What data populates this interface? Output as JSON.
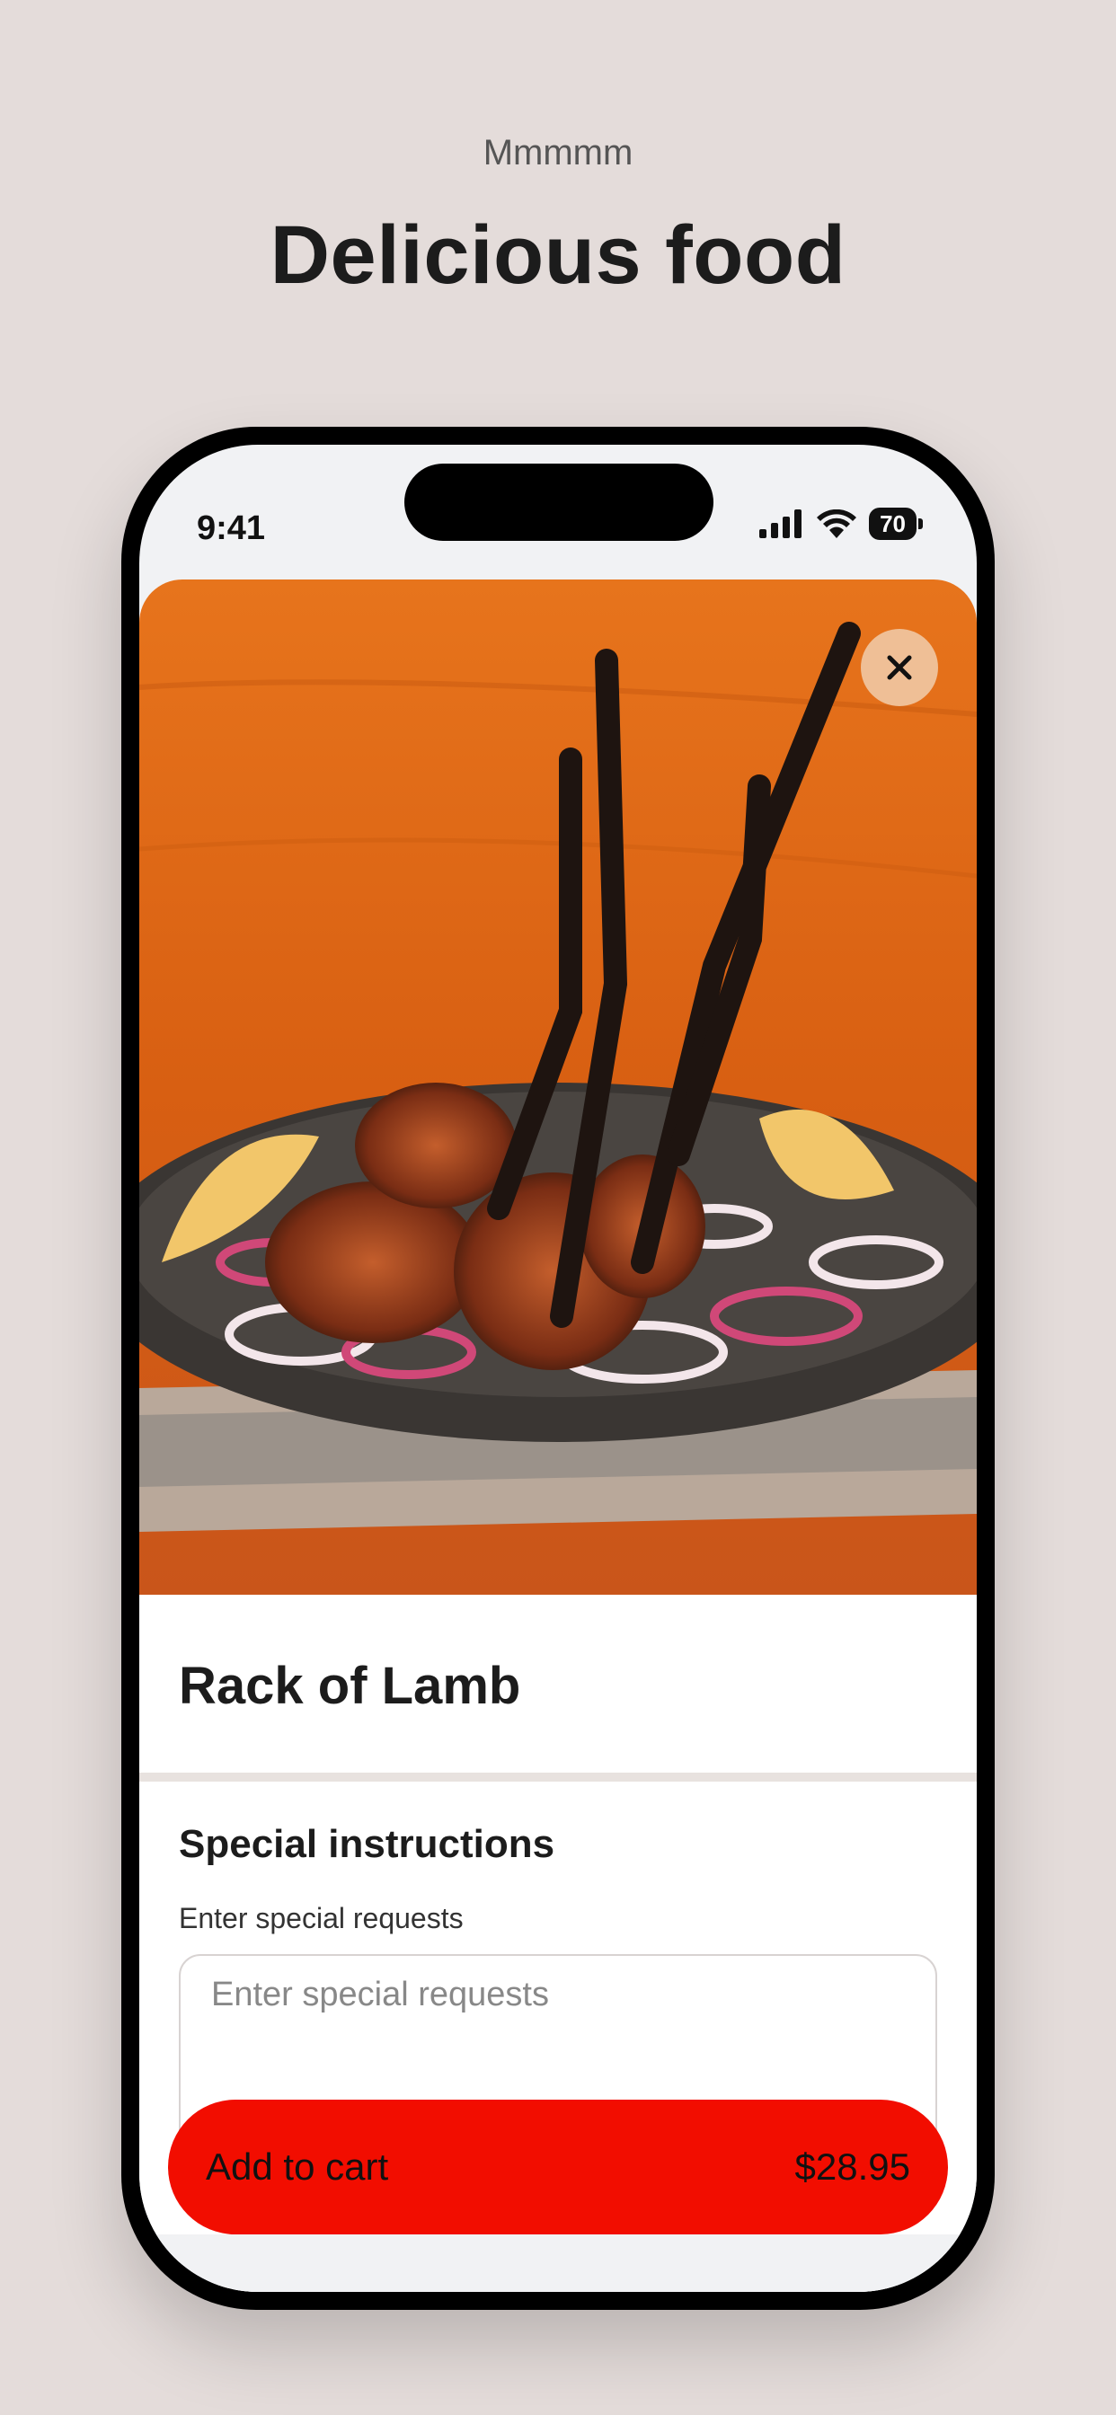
{
  "promo": {
    "subtitle": "Mmmmm",
    "title": "Delicious food"
  },
  "status_bar": {
    "time": "9:41",
    "battery": "70"
  },
  "item": {
    "name": "Rack of Lamb",
    "image_icon": "food-photo"
  },
  "special_instructions": {
    "title": "Special instructions",
    "label": "Enter special requests",
    "placeholder": "Enter special requests",
    "value": ""
  },
  "cart_button": {
    "label": "Add to cart",
    "price": "$28.95"
  },
  "colors": {
    "background": "#e4dcda",
    "cart_button": "#f20d00",
    "close_button": "#efbf96"
  }
}
